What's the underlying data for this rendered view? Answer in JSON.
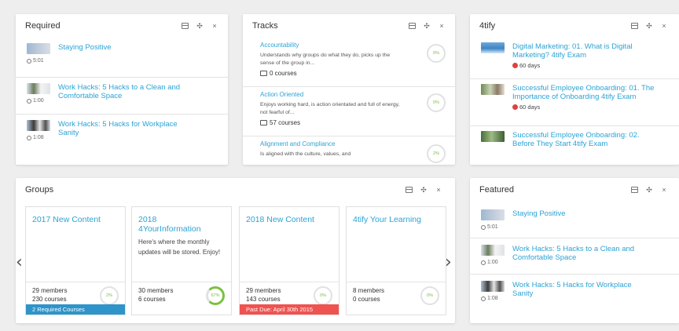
{
  "required": {
    "title": "Required",
    "items": [
      {
        "title": "Staying Positive",
        "duration": "5:01"
      },
      {
        "title": "Work Hacks: 5 Hacks to a Clean and Comfortable Space",
        "duration": "1:00"
      },
      {
        "title": "Work Hacks: 5 Hacks for Workplace Sanity",
        "duration": "1:08"
      }
    ]
  },
  "tracks": {
    "title": "Tracks",
    "items": [
      {
        "title": "Accountability",
        "desc": "Understands why groups do what they do, picks up the sense of the group in...",
        "courses": "0 courses",
        "progress": "0%"
      },
      {
        "title": "Action Oriented",
        "desc": "Enjoys working hard, is action orientated and full of energy, not fearful of...",
        "courses": "57 courses",
        "progress": "0%"
      },
      {
        "title": "Alignment and Compliance",
        "desc": "Is aligned with the culture, values, and",
        "courses": "",
        "progress": "2%"
      }
    ]
  },
  "fourtify": {
    "title": "4tify",
    "items": [
      {
        "title": "Digital Marketing: 01. What is Digital Marketing? 4tify Exam",
        "days": "60 days"
      },
      {
        "title": "Successful Employee Onboarding: 01. The Importance of Onboarding 4tify Exam",
        "days": "60 days"
      },
      {
        "title": "Successful Employee Onboarding: 02. Before They Start 4tify Exam",
        "days": ""
      }
    ]
  },
  "groups": {
    "title": "Groups",
    "cards": [
      {
        "title": "2017 New Content",
        "desc": "",
        "members": "29 members",
        "courses": "230 courses",
        "progress": "2%",
        "banner": "2 Required Courses",
        "banner_color": "#2e94c9"
      },
      {
        "title": "2018 4YourInformation",
        "desc": "Here's where the monthly updates will be stored. Enjoy!",
        "members": "30 members",
        "courses": "6 courses",
        "progress": "67%",
        "banner": "",
        "banner_color": ""
      },
      {
        "title": "2018 New Content",
        "desc": "",
        "members": "29 members",
        "courses": "143 courses",
        "progress": "0%",
        "banner": "Past Due: April 30th 2015",
        "banner_color": "#ef5350"
      },
      {
        "title": "4tify Your Learning",
        "desc": "",
        "members": "8 members",
        "courses": "0 courses",
        "progress": "0%",
        "banner": "",
        "banner_color": ""
      }
    ]
  },
  "featured": {
    "title": "Featured",
    "items": [
      {
        "title": "Staying Positive",
        "duration": "5:01"
      },
      {
        "title": "Work Hacks: 5 Hacks to a Clean and Comfortable Space",
        "duration": "1:00"
      },
      {
        "title": "Work Hacks: 5 Hacks for Workplace Sanity",
        "duration": "1:08"
      }
    ]
  },
  "controls": {
    "minimize": "",
    "move": "✣",
    "close": "×"
  },
  "nav": {
    "prev": "‹",
    "next": "›"
  }
}
